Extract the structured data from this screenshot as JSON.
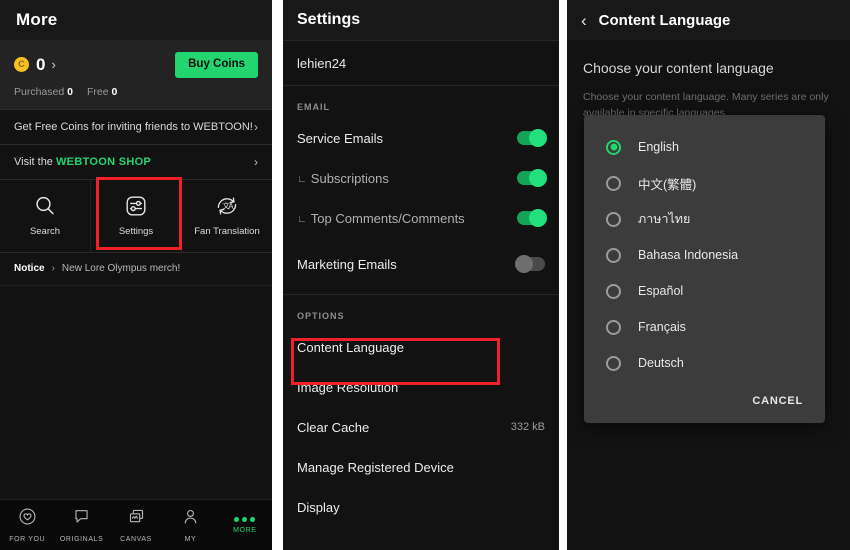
{
  "colors": {
    "brand_green": "#22d56f",
    "highlight_red": "#f01f28",
    "panel_bg": "#121212",
    "dialog_bg": "#3c3c3c",
    "coin_gold": "#f6c026"
  },
  "more_panel": {
    "header_title": "More",
    "coins": {
      "icon": "coin-icon",
      "amount": "0",
      "chevron": "›",
      "buy_label": "Buy Coins",
      "purchased_label": "Purchased",
      "purchased_value": "0",
      "free_label": "Free",
      "free_value": "0"
    },
    "links": [
      {
        "text": "Get Free Coins for inviting friends to WEBTOON!",
        "chevron": "›"
      }
    ],
    "shop_link": {
      "prefix": "Visit the ",
      "brand": "WEBTOON SHOP",
      "chevron": "›"
    },
    "icon_grid": [
      {
        "label": "Search",
        "icon": "search-icon"
      },
      {
        "label": "Settings",
        "icon": "sliders-icon"
      },
      {
        "label": "Fan Translation",
        "icon": "translate-icon"
      }
    ],
    "notice": {
      "key": "Notice",
      "chevron": "›",
      "value": "New Lore Olympus merch!"
    },
    "bottom_nav": [
      {
        "label": "FOR YOU",
        "icon": "heart-circle-icon",
        "active": false
      },
      {
        "label": "ORIGINALS",
        "icon": "speech-bubble-icon",
        "active": false
      },
      {
        "label": "CANVAS",
        "icon": "canvas-cards-icon",
        "active": false
      },
      {
        "label": "MY",
        "icon": "person-icon",
        "active": false
      },
      {
        "label": "MORE",
        "icon": "three-dots-icon",
        "active": true
      }
    ]
  },
  "settings_panel": {
    "header_title": "Settings",
    "account_username": "lehien24",
    "email_section_label": "EMAIL",
    "email_rows": [
      {
        "label": "Service Emails",
        "sub": false,
        "toggle": "on"
      },
      {
        "label": "Subscriptions",
        "sub": true,
        "corner": "∟",
        "toggle": "on"
      },
      {
        "label": "Top Comments/Comments",
        "sub": true,
        "corner": "∟",
        "toggle": "on"
      },
      {
        "label": "Marketing Emails",
        "sub": false,
        "toggle": "off"
      }
    ],
    "options_section_label": "OPTIONS",
    "option_rows": [
      {
        "label": "Content Language",
        "value": ""
      },
      {
        "label": "Image Resolution",
        "value": ""
      },
      {
        "label": "Clear Cache",
        "value": "332 kB"
      },
      {
        "label": "Manage Registered Device",
        "value": ""
      },
      {
        "label": "Display",
        "value": ""
      }
    ]
  },
  "language_panel": {
    "back_icon": "‹",
    "header_title": "Content Language",
    "heading": "Choose your content language",
    "description": "Choose your content language. Many series are only available in specific languages.",
    "dialog": {
      "options": [
        {
          "label": "English",
          "selected": true
        },
        {
          "label": "中文(繁體)",
          "selected": false
        },
        {
          "label": "ภาษาไทย",
          "selected": false
        },
        {
          "label": "Bahasa Indonesia",
          "selected": false
        },
        {
          "label": "Español",
          "selected": false
        },
        {
          "label": "Français",
          "selected": false
        },
        {
          "label": "Deutsch",
          "selected": false
        }
      ],
      "cancel_label": "CANCEL"
    }
  }
}
